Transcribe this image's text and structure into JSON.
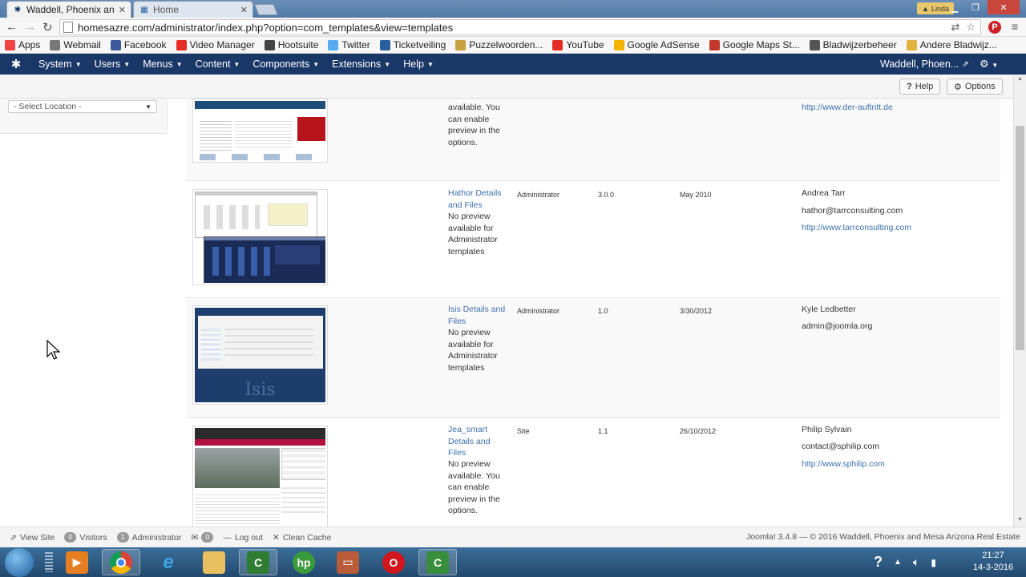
{
  "browser": {
    "tabs": [
      {
        "title": "Waddell, Phoenix an",
        "active": true
      },
      {
        "title": "Home",
        "active": false
      }
    ],
    "user_badge": "Linda",
    "url": "homesazre.com/administrator/index.php?option=com_templates&view=templates"
  },
  "bookmarks": [
    {
      "label": "Apps",
      "icon": "apps-grid-icon",
      "color": "#e44"
    },
    {
      "label": "Webmail",
      "icon": "webmail-icon",
      "color": "#777"
    },
    {
      "label": "Facebook",
      "icon": "facebook-icon",
      "color": "#3b5998"
    },
    {
      "label": "Video Manager",
      "icon": "youtube-icon",
      "color": "#e52d27"
    },
    {
      "label": "Hootsuite",
      "icon": "hootsuite-icon",
      "color": "#444"
    },
    {
      "label": "Twitter",
      "icon": "twitter-icon",
      "color": "#55acee"
    },
    {
      "label": "Ticketveiling",
      "icon": "ticket-icon",
      "color": "#2a5f9e"
    },
    {
      "label": "Puzzelwoorden...",
      "icon": "puzzle-icon",
      "color": "#c9a040"
    },
    {
      "label": "YouTube",
      "icon": "youtube-icon",
      "color": "#e52d27"
    },
    {
      "label": "Google AdSense",
      "icon": "adsense-icon",
      "color": "#f4b400"
    },
    {
      "label": "Google Maps St...",
      "icon": "maps-icon",
      "color": "#c0392b"
    },
    {
      "label": "Bladwijzerbeheer",
      "icon": "star-icon",
      "color": "#555"
    },
    {
      "label": "Andere Bladwijz...",
      "icon": "folder-icon",
      "color": "#e3b341"
    }
  ],
  "joomla_nav": {
    "menus": [
      "System",
      "Users",
      "Menus",
      "Content",
      "Components",
      "Extensions",
      "Help"
    ],
    "site_link": "Waddell, Phoen..."
  },
  "toolbar": {
    "help_label": "Help",
    "options_label": "Options"
  },
  "sidebar": {
    "location_select": "- Select Location -"
  },
  "templates": [
    {
      "name": "",
      "description": "available. You can enable preview in the options.",
      "location": "",
      "version": "",
      "date": "",
      "author": "",
      "email": "",
      "url": "http://www.der-auftritt.de",
      "thumb": "red-theme"
    },
    {
      "name": "Hathor Details and Files",
      "description": "No preview available for Administrator templates",
      "location": "Administrator",
      "version": "3.0.0",
      "date": "May 2010",
      "author": "Andrea Tarr",
      "email": "hathor@tarrconsulting.com",
      "url": "http://www.tarrconsulting.com",
      "thumb": "hathor"
    },
    {
      "name": "Isis Details and Files",
      "description": "No preview available for Administrator templates",
      "location": "Administrator",
      "version": "1.0",
      "date": "3/30/2012",
      "author": "Kyle Ledbetter",
      "email": "admin@joomla.org",
      "url": "",
      "thumb": "isis"
    },
    {
      "name": "Jea_smart Details and Files",
      "description": "No preview available. You can enable preview in the options.",
      "location": "Site",
      "version": "1.1",
      "date": "26/10/2012",
      "author": "Philip Sylvain",
      "email": "contact@sphilip.com",
      "url": "http://www.sphilip.com",
      "thumb": "jea"
    }
  ],
  "isis_thumb_text": "Isis",
  "statusbar": {
    "view_site": "View Site",
    "visitors_count": "0",
    "visitors_label": "Visitors",
    "admin_count": "1",
    "admin_label": "Administrator",
    "messages_count": "0",
    "logout": "Log out",
    "clean_cache": "Clean Cache",
    "footer": "Joomla! 3.4.8 — © 2016 Waddell, Phoenix and Mesa Arizona Real Estate"
  },
  "taskbar": {
    "time": "21:27",
    "date": "14-3-2016"
  },
  "colors": {
    "joomla_nav": "#1a3867",
    "link": "#3d6fa9",
    "taskbar": "#2c5a84"
  }
}
